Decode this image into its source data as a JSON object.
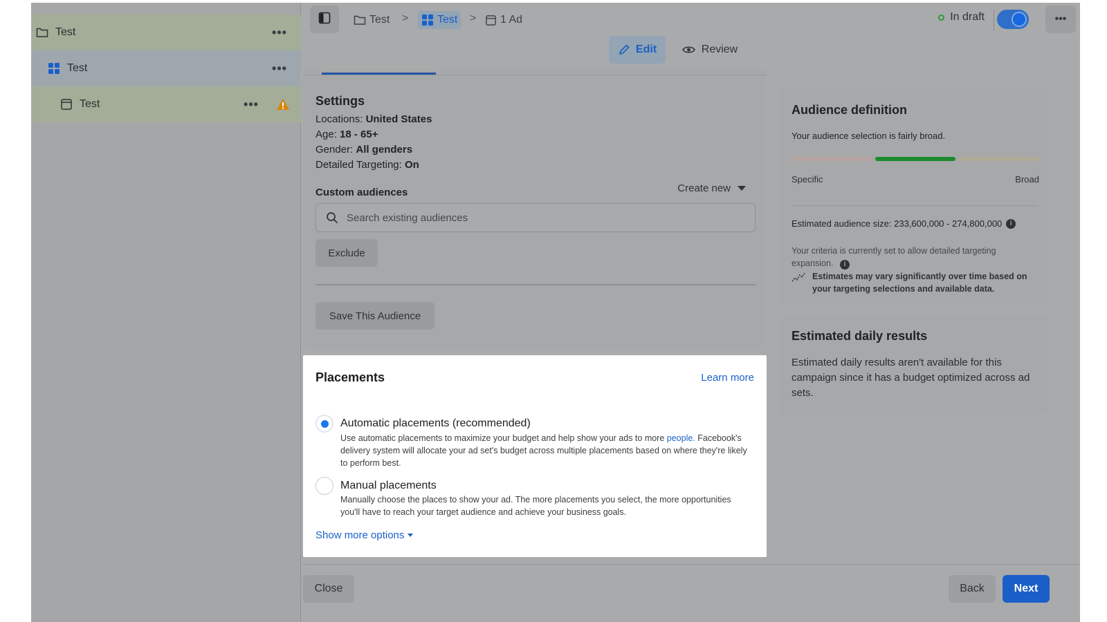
{
  "sidebar": {
    "items": [
      {
        "label": "Test",
        "icon": "folder-icon",
        "level": "campaign"
      },
      {
        "label": "Test",
        "icon": "grid-icon",
        "level": "ad-set"
      },
      {
        "label": "Test",
        "icon": "ad-icon",
        "level": "ad",
        "warning": true
      }
    ],
    "more_label": "•••"
  },
  "header": {
    "breadcrumbs": [
      {
        "label": "Test",
        "icon": "folder-icon"
      },
      {
        "label": "Test",
        "icon": "grid-icon"
      },
      {
        "label": "1 Ad",
        "icon": "ad-icon"
      }
    ],
    "separator": ">",
    "status": "In draft",
    "status_color": "#2e9c3a",
    "toggle_on": true,
    "more_label": "•••",
    "tabs": {
      "edit": "Edit",
      "review": "Review"
    }
  },
  "audience": {
    "settings_title": "Settings",
    "settings": [
      {
        "label": "Locations:",
        "value": "United States"
      },
      {
        "label": "Age:",
        "value": "18 - 65+"
      },
      {
        "label": "Gender:",
        "value": "All genders"
      },
      {
        "label": "Detailed Targeting:",
        "value": "On"
      }
    ],
    "custom_title": "Custom audiences",
    "create_new": "Create new",
    "search_placeholder": "Search existing audiences",
    "exclude_label": "Exclude",
    "save_label": "Save This Audience"
  },
  "placements": {
    "title": "Placements",
    "learn_more": "Learn more",
    "automatic": {
      "title": "Automatic placements (recommended)",
      "desc_before": "Use automatic placements to maximize your budget and help show your ads to more ",
      "desc_link": "people.",
      "desc_after": " Facebook's delivery system will allocate your ad set's budget across multiple placements based on where they're likely to perform best.",
      "selected": true
    },
    "manual": {
      "title": "Manual placements",
      "desc": "Manually choose the places to show your ad. The more placements you select, the more opportunities you'll have to reach your target audience and achieve your business goals.",
      "selected": false
    },
    "show_more": "Show more options"
  },
  "audience_definition": {
    "title": "Audience definition",
    "subtitle": "Your audience selection is fairly broad.",
    "meter_level": "broad-middle",
    "specific_label": "Specific",
    "broad_label": "Broad",
    "estimated_size": "Estimated audience size: 233,600,000 - 274,800,000",
    "criteria_note": "Your criteria is currently set to allow detailed targeting expansion.",
    "vary_note": "Estimates may vary significantly over time based on your targeting selections and available data."
  },
  "estimated_daily": {
    "title": "Estimated daily results",
    "text": "Estimated daily results aren't available for this campaign since it has a budget optimized across ad sets."
  },
  "footer": {
    "close": "Close",
    "back": "Back",
    "next": "Next"
  },
  "colors": {
    "accent": "#1877f2",
    "next_button": "#1a5fc8",
    "link": "#1b61c9"
  }
}
